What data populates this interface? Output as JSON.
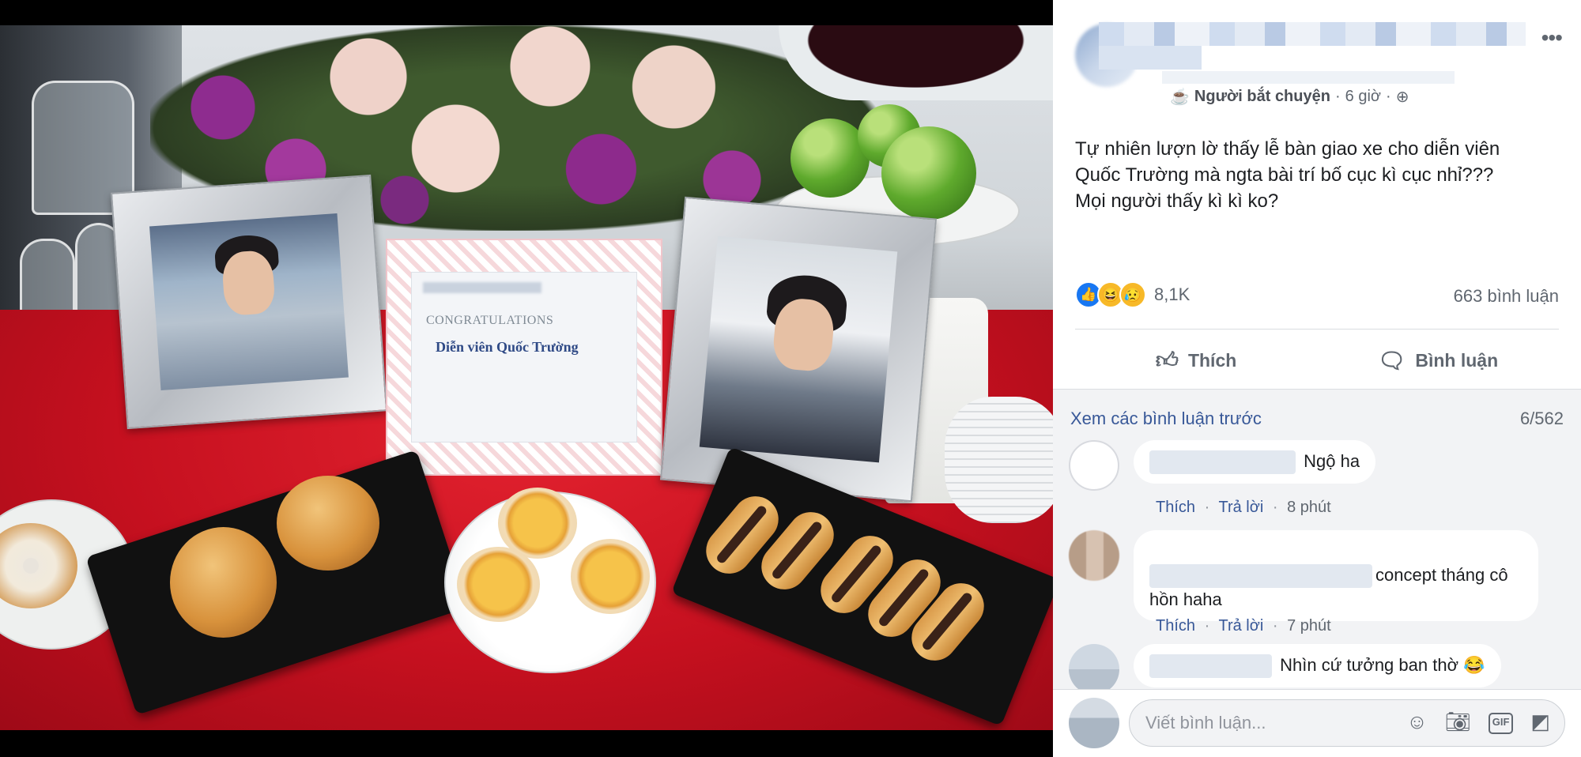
{
  "photo": {
    "card_congrats": "CONGRATULATIONS",
    "card_name": "Diễn viên Quốc Trường"
  },
  "post": {
    "meta": {
      "role_icon": "cup-icon",
      "role": "Người bắt chuyện",
      "separator": "·",
      "time": "6 giờ",
      "privacy_icon": "globe-icon"
    },
    "more_icon": "•••",
    "text": "Tự nhiên lượn lờ thấy lễ bàn giao xe cho diễn viên\nQuốc Trường mà ngta bài trí bố cục kì cục nhỉ???\nMọi người thấy kì kì ko?",
    "reactions": {
      "icons": [
        "like-icon",
        "haha-icon",
        "sad-icon"
      ],
      "count": "8,1K"
    },
    "comments_count": "663 bình luận",
    "actions": {
      "like_label": "Thích",
      "comment_label": "Bình luận"
    }
  },
  "comments": {
    "view_previous": "Xem các bình luận trước",
    "page_count": "6/562",
    "items": [
      {
        "text": "Ngộ ha",
        "like": "Thích",
        "reply": "Trả lời",
        "time": "8 phút"
      },
      {
        "text": "concept tháng cô\nhồn haha",
        "like": "Thích",
        "reply": "Trả lời",
        "time": "7 phút"
      },
      {
        "text": "Nhìn cứ tưởng ban thờ 😂"
      }
    ],
    "separator": "·"
  },
  "composer": {
    "placeholder": "Viết bình luận..."
  },
  "colors": {
    "link": "#385898",
    "like_blue": "#1877f2",
    "muted": "#606770",
    "panel_bg": "#f2f3f5"
  }
}
